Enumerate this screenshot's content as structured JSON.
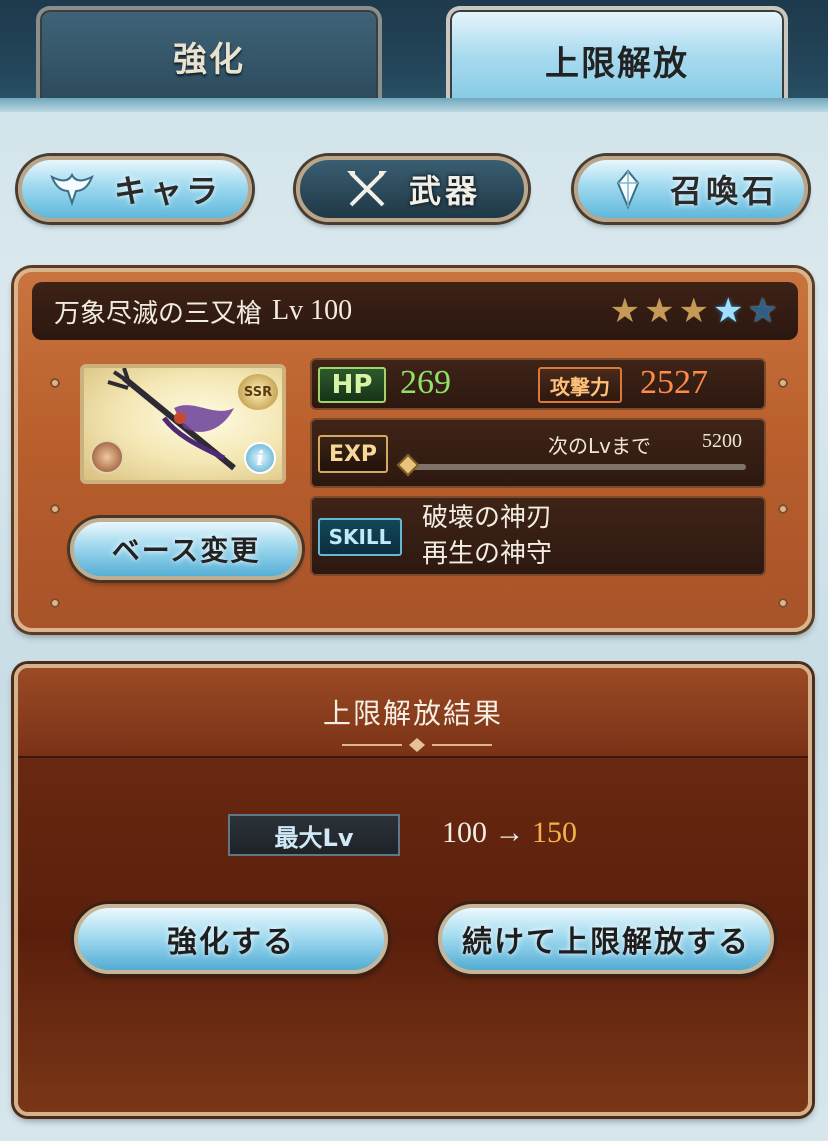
{
  "tabs": {
    "enhance": "強化",
    "limit_break": "上限解放"
  },
  "categories": {
    "chara": "キャラ",
    "weapon": "武器",
    "summon": "召喚石"
  },
  "weapon": {
    "name": "万象尽滅の三又槍",
    "level": "Lv 100",
    "rarity": "SSR",
    "stars": {
      "filled": 3,
      "uncapped": 1,
      "total": 5
    },
    "hp_label": "HP",
    "hp": "269",
    "atk_label": "攻撃力",
    "atk": "2527",
    "exp_label": "EXP",
    "exp_next_label": "次のLvまで",
    "exp_next_value": "5200",
    "exp_progress": 0,
    "skill_label": "SKILL",
    "skills": [
      "破壊の神刃",
      "再生の神守"
    ],
    "info_icon": "i"
  },
  "base_change": "ベース変更",
  "result": {
    "title": "上限解放結果",
    "max_lv_label": "最大Lv",
    "from": "100",
    "arrow": "→",
    "to": "150"
  },
  "actions": {
    "enhance": "強化する",
    "continue": "続けて上限解放する"
  },
  "icons": {
    "chara": "winged-crest-icon",
    "weapon": "crossed-weapons-icon",
    "summon": "crystal-icon",
    "element": "element-icon",
    "info": "info-icon"
  }
}
